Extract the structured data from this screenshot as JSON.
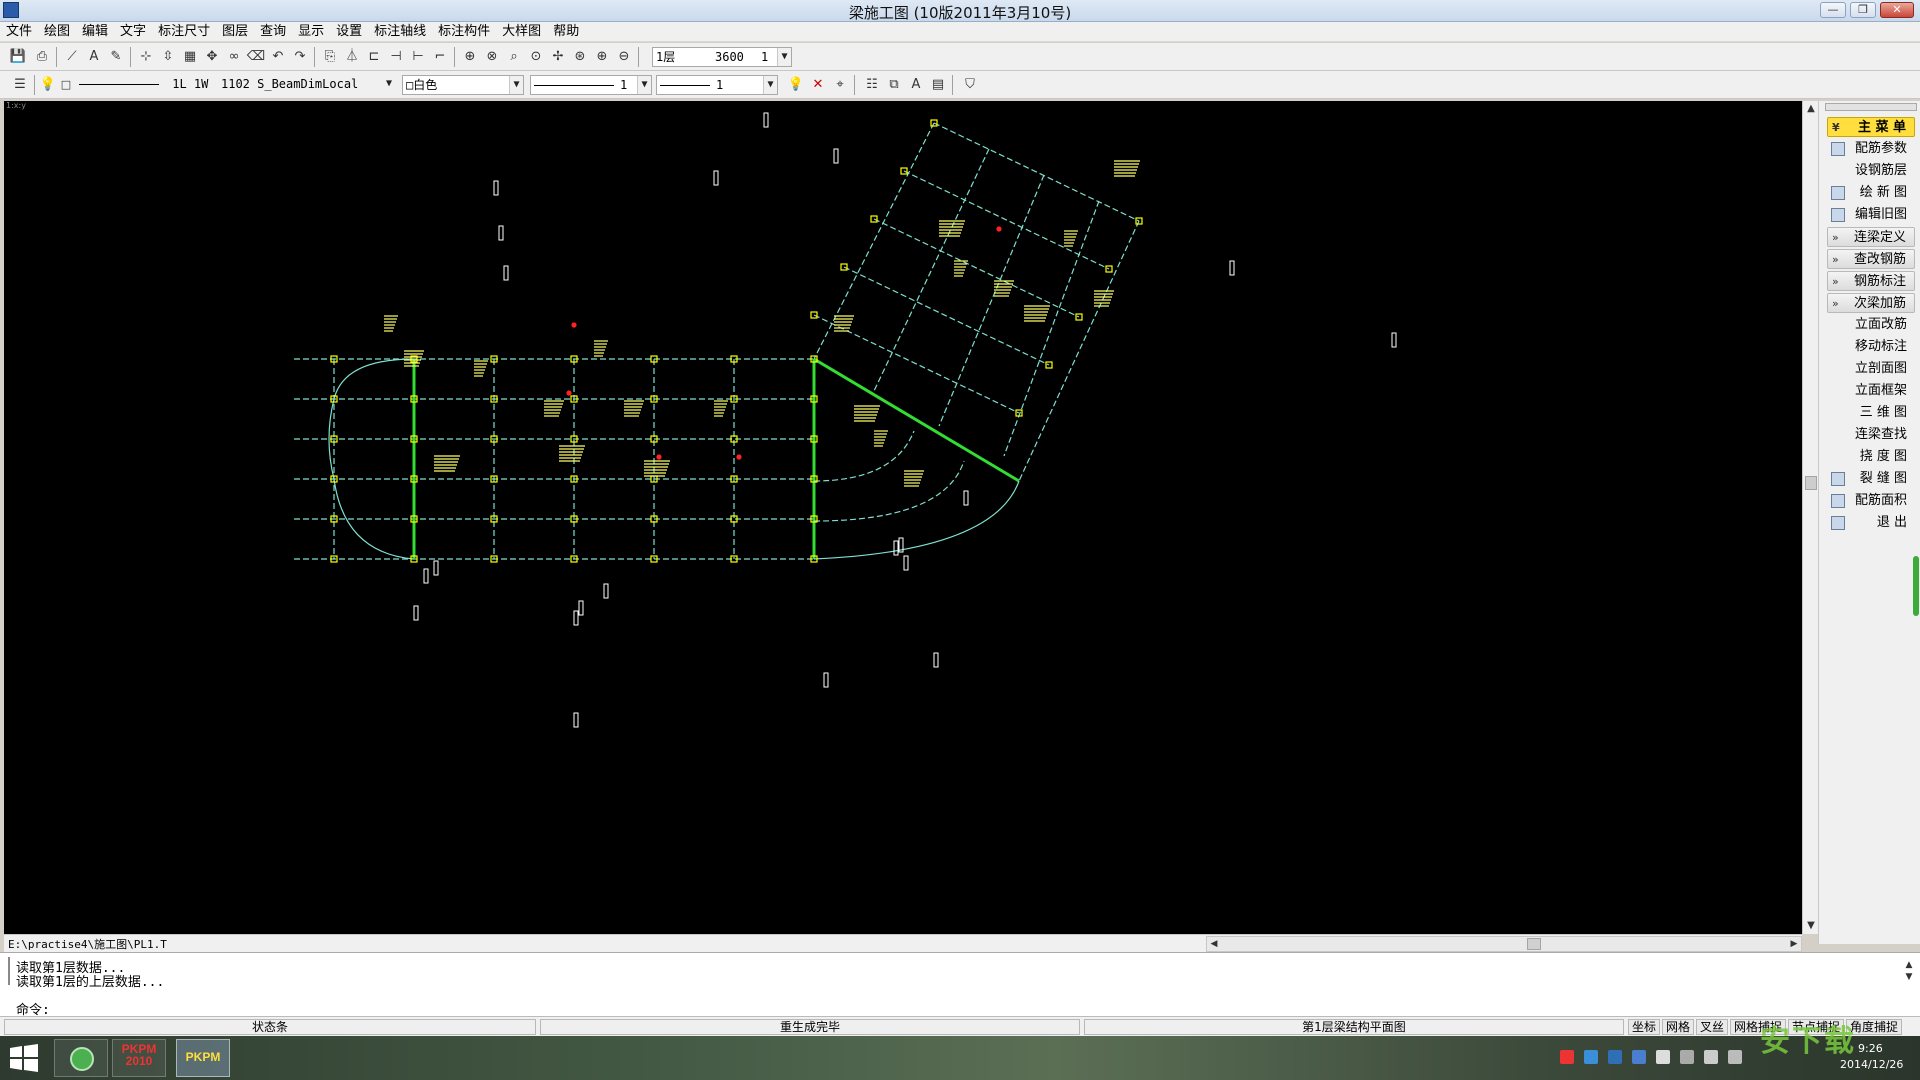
{
  "window": {
    "title": "梁施工图 (10版2011年3月10号)",
    "minimize": "—",
    "maximize": "❐",
    "close": "✕"
  },
  "menu": [
    "文件",
    "绘图",
    "编辑",
    "文字",
    "标注尺寸",
    "图层",
    "查询",
    "显示",
    "设置",
    "标注轴线",
    "标注构件",
    "大样图",
    "帮助"
  ],
  "toolbar1": {
    "floor": "1层",
    "height": "3600",
    "count": "1"
  },
  "toolbar2": {
    "layer_line_text": "1L 1W",
    "layer_name": "1102 S_BeamDimLocal",
    "color": "白色",
    "linetype_value": "1",
    "linewidth_value": "1"
  },
  "canvas": {
    "view_label": "1:x:y"
  },
  "right_menu": {
    "main": "主 菜 单",
    "items": [
      {
        "label": "配筋参数",
        "kind": "icon"
      },
      {
        "label": "设钢筋层",
        "kind": "plain"
      },
      {
        "label": "绘 新 图",
        "kind": "icon"
      },
      {
        "label": "编辑旧图",
        "kind": "icon"
      },
      {
        "label": "连梁定义",
        "kind": "section"
      },
      {
        "label": "查改钢筋",
        "kind": "section"
      },
      {
        "label": "钢筋标注",
        "kind": "section"
      },
      {
        "label": "次梁加筋",
        "kind": "section"
      },
      {
        "label": "立面改筋",
        "kind": "plain"
      },
      {
        "label": "移动标注",
        "kind": "plain"
      },
      {
        "label": "立剖面图",
        "kind": "plain"
      },
      {
        "label": "立面框架",
        "kind": "plain"
      },
      {
        "label": "三 维 图",
        "kind": "plain"
      },
      {
        "label": "连梁查找",
        "kind": "plain"
      },
      {
        "label": "挠 度 图",
        "kind": "plain"
      },
      {
        "label": "裂 缝 图",
        "kind": "icon"
      },
      {
        "label": "配筋面积",
        "kind": "icon"
      },
      {
        "label": "退    出",
        "kind": "icon"
      }
    ]
  },
  "file_path": "E:\\practise4\\施工图\\PL1.T",
  "command": {
    "lines": [
      "读取第1层数据...",
      "读取第1层的上层数据..."
    ],
    "prompt": "命令:",
    "value": ""
  },
  "status": {
    "cell1": "状态条",
    "cell2": "重生成完毕",
    "cell3": "第1层梁结构平面图",
    "toggles": [
      "坐标",
      "网格",
      "叉丝",
      "网格捕捉",
      "节点捕捉",
      "角度捕捉"
    ]
  },
  "taskbar": {
    "apps": [
      "PKPM 2010",
      "PKPM"
    ],
    "time": "9:26",
    "date": "2014/12/26"
  },
  "watermark": "安下载",
  "colors": {
    "canvas_bg": "#000000",
    "axis": "#7fe0d0",
    "column": "#ffff00",
    "rebar": "#ffff66",
    "green_beam": "#33dd33",
    "highlight": "#ff2222"
  }
}
